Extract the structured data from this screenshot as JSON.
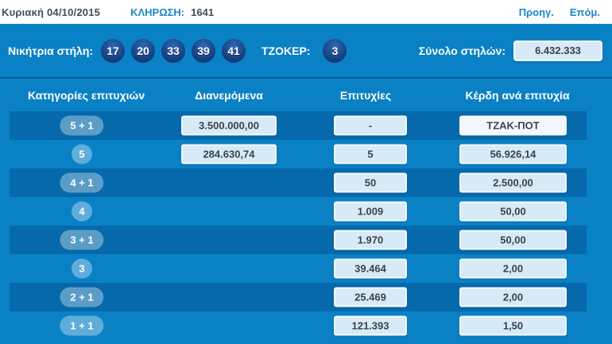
{
  "topbar": {
    "date": "Κυριακή 04/10/2015",
    "draw_label": "ΚΛΗΡΩΣΗ:",
    "draw_number": "1641",
    "prev_label": "Προηγ.",
    "next_label": "Επόμ."
  },
  "winning": {
    "label": "Νικήτρια στήλη:",
    "numbers": [
      "17",
      "20",
      "33",
      "39",
      "41"
    ],
    "joker_label": "ΤΖΟΚΕΡ:",
    "joker_number": "3",
    "columns_label": "Σύνολο στηλών:",
    "columns_total": "6.432.333"
  },
  "table": {
    "headers": {
      "category": "Κατηγορίες επιτυχιών",
      "distributed": "Διανεμόμενα",
      "hits": "Επιτυχίες",
      "winnings": "Κέρδη ανά επιτυχία"
    },
    "rows": [
      {
        "category": "5 + 1",
        "distributed": "3.500.000,00",
        "hits": "-",
        "winnings": "ΤΖΑΚ-ΠΟΤ"
      },
      {
        "category": "5",
        "distributed": "284.630,74",
        "hits": "5",
        "winnings": "56.926,14"
      },
      {
        "category": "4 + 1",
        "hits": "50",
        "winnings": "2.500,00"
      },
      {
        "category": "4",
        "hits": "1.009",
        "winnings": "50,00"
      },
      {
        "category": "3 + 1",
        "hits": "1.970",
        "winnings": "50,00"
      },
      {
        "category": "3",
        "hits": "39.464",
        "winnings": "2,00"
      },
      {
        "category": "2 + 1",
        "hits": "25.469",
        "winnings": "2,00"
      },
      {
        "category": "1 + 1",
        "hits": "121.393",
        "winnings": "1,50"
      }
    ]
  },
  "colors": {
    "background_blue": "#0a81c5",
    "dark_row_blue": "#0569ab",
    "link_blue": "#1b87c8",
    "ball_navy": "#1e4d92",
    "box_fill": "#d7eaf7",
    "dark_text": "#3b4f60"
  }
}
